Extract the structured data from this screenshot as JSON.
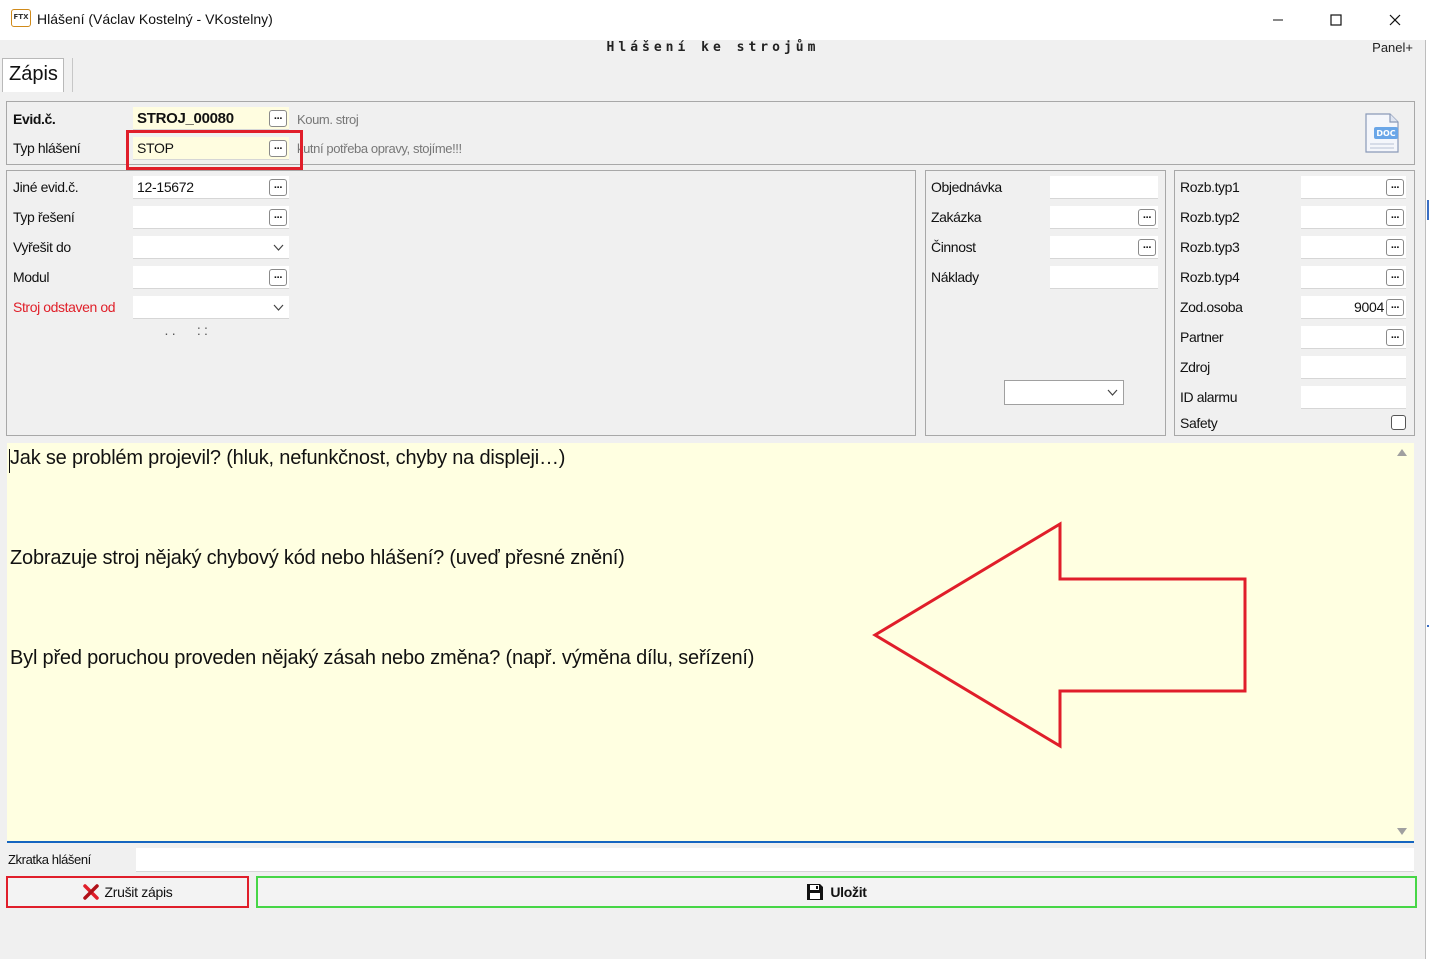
{
  "window": {
    "title": "Hlášení (Václav Kostelný - VKostelny)",
    "app_icon_text": "FTX",
    "subtitle": "Hlášení ke strojům",
    "panel_link": "Panel+"
  },
  "tabs": [
    {
      "label": "Zápis"
    }
  ],
  "header": {
    "evid_label": "Evid.č.",
    "evid_value": "STROJ_00080",
    "evid_desc": "Koum. stroj",
    "typ_label": "Typ hlášení",
    "typ_value": "STOP",
    "typ_desc": "kutní potřeba opravy, stojíme!!!",
    "doc_icon_text": "DOC"
  },
  "left_group": {
    "fields": [
      {
        "label": "Jiné evid.č.",
        "value": "12-15672"
      },
      {
        "label": "Typ řešení",
        "value": ""
      },
      {
        "label": "Vyřešit do",
        "value": ""
      },
      {
        "label": "Modul",
        "value": ""
      },
      {
        "label": "Stroj odstaven od",
        "value": ". .      : :"
      }
    ]
  },
  "middle_group": {
    "fields": [
      {
        "label": "Objednávka",
        "value": ""
      },
      {
        "label": "Zakázka",
        "value": ""
      },
      {
        "label": "Činnost",
        "value": ""
      },
      {
        "label": "Náklady",
        "value": ""
      }
    ],
    "combo_value": ""
  },
  "right_group": {
    "fields": [
      {
        "label": "Rozb.typ1",
        "value": ""
      },
      {
        "label": "Rozb.typ2",
        "value": ""
      },
      {
        "label": "Rozb.typ3",
        "value": ""
      },
      {
        "label": "Rozb.typ4",
        "value": ""
      },
      {
        "label": "Zod.osoba",
        "value": "9004"
      },
      {
        "label": "Partner",
        "value": ""
      },
      {
        "label": "Zdroj",
        "value": ""
      },
      {
        "label": "ID alarmu",
        "value": ""
      },
      {
        "label": "Safety",
        "checked": false
      }
    ]
  },
  "description": {
    "lines": [
      "Jak se problém projevil? (hluk, nefunkčnost, chyby na displeji…)",
      "Zobrazuje stroj nějaký chybový kód nebo hlášení? (uveď přesné znění)",
      "Byl před poruchou proveden nějaký zásah nebo změna? (např. výměna dílu, seřízení)"
    ]
  },
  "footer": {
    "shortcut_label": "Zkratka hlášení",
    "shortcut_value": "",
    "cancel_label": "Zrušit zápis",
    "save_label": "Uložit"
  },
  "colors": {
    "highlight_red": "#e01e2a",
    "save_green": "#46d646",
    "textarea_bg": "#ffffe1",
    "field_yellow": "#fffde0",
    "accent_blue": "#1565c0"
  }
}
